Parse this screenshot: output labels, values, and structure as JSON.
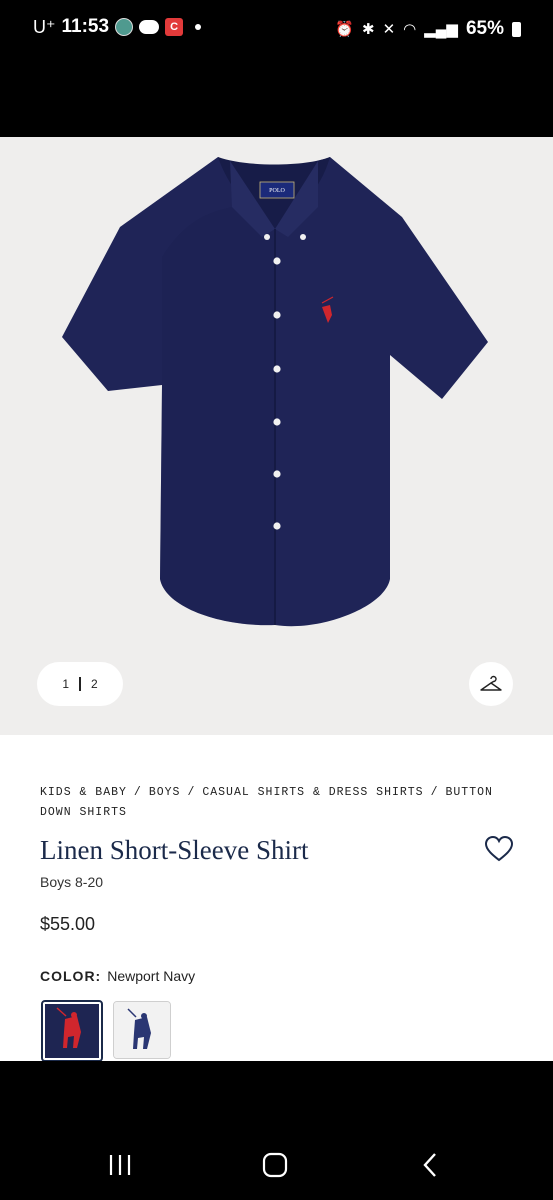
{
  "status_bar": {
    "carrier": "U⁺",
    "time": "11:53",
    "battery": "65%"
  },
  "gallery": {
    "page_current": "1",
    "page_total": "2",
    "hanger_icon": "hanger-icon"
  },
  "breadcrumb": [
    "KIDS & BABY",
    "BOYS",
    "CASUAL SHIRTS & DRESS SHIRTS",
    "BUTTON DOWN SHIRTS"
  ],
  "product": {
    "title": "Linen Short-Sleeve Shirt",
    "subtitle": "Boys 8-20",
    "price": "$55.00",
    "color_label": "COLOR:",
    "color_value": "Newport Navy",
    "swatches": [
      {
        "name": "Newport Navy",
        "selected": true,
        "color": "#1e2552"
      },
      {
        "name": "White",
        "selected": false,
        "color": "#f2f2f2"
      }
    ]
  },
  "colors": {
    "shirt": "#1f2457",
    "accent": "#1b2a4a",
    "logo": "#d0262d"
  }
}
